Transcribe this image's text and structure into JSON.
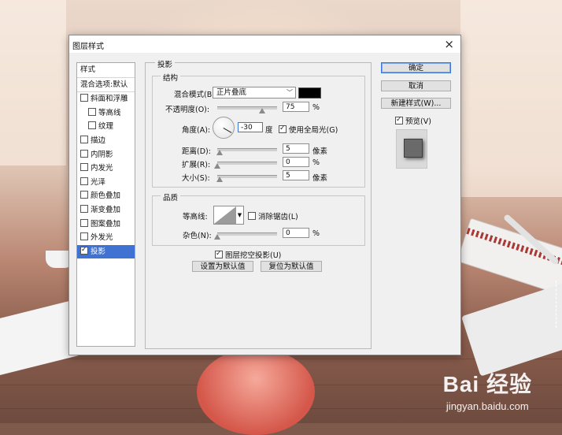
{
  "dialog": {
    "title": "图层样式",
    "close_glyph": "×"
  },
  "sidebar": {
    "items": [
      {
        "label": "样式",
        "checkbox": false
      },
      {
        "label": "混合选项:默认",
        "checkbox": false
      },
      {
        "label": "斜面和浮雕",
        "checkbox": true,
        "checked": false
      },
      {
        "label": "等高线",
        "checkbox": true,
        "checked": false
      },
      {
        "label": "纹理",
        "checkbox": true,
        "checked": false
      },
      {
        "label": "描边",
        "checkbox": true,
        "checked": false
      },
      {
        "label": "内阴影",
        "checkbox": true,
        "checked": false
      },
      {
        "label": "内发光",
        "checkbox": true,
        "checked": false
      },
      {
        "label": "光泽",
        "checkbox": true,
        "checked": false
      },
      {
        "label": "颜色叠加",
        "checkbox": true,
        "checked": false
      },
      {
        "label": "渐变叠加",
        "checkbox": true,
        "checked": false
      },
      {
        "label": "图案叠加",
        "checkbox": true,
        "checked": false
      },
      {
        "label": "外发光",
        "checkbox": true,
        "checked": false
      },
      {
        "label": "投影",
        "checkbox": true,
        "checked": true,
        "selected": true
      }
    ]
  },
  "panel": {
    "title": "投影",
    "structure": {
      "title": "结构",
      "blend_mode_label": "混合模式(B):",
      "blend_mode_value": "正片叠底",
      "blend_color": "#000000",
      "opacity_label": "不透明度(O):",
      "opacity_value": "75",
      "opacity_unit": "%",
      "opacity_fraction": 0.75,
      "angle_label": "角度(A):",
      "angle_value": "-30",
      "angle_unit": "度",
      "global_light_label": "使用全局光(G)",
      "global_light_checked": true,
      "distance_label": "距离(D):",
      "distance_value": "5",
      "distance_unit": "像素",
      "spread_label": "扩展(R):",
      "spread_value": "0",
      "spread_unit": "%",
      "size_label": "大小(S):",
      "size_value": "5",
      "size_unit": "像素"
    },
    "quality": {
      "title": "品质",
      "contour_label": "等高线:",
      "antialias_label": "消除锯齿(L)",
      "antialias_checked": false,
      "noise_label": "杂色(N):",
      "noise_value": "0",
      "noise_unit": "%"
    },
    "knockout_label": "图层挖空投影(U)",
    "knockout_checked": true,
    "make_default_label": "设置为默认值",
    "reset_default_label": "复位为默认值"
  },
  "actions": {
    "ok_label": "确定",
    "cancel_label": "取消",
    "new_style_label": "新建样式(W)...",
    "preview_label": "预览(V)",
    "preview_checked": true
  },
  "watermark": {
    "logo": "Bai 经验",
    "url": "jingyan.baidu.com"
  }
}
